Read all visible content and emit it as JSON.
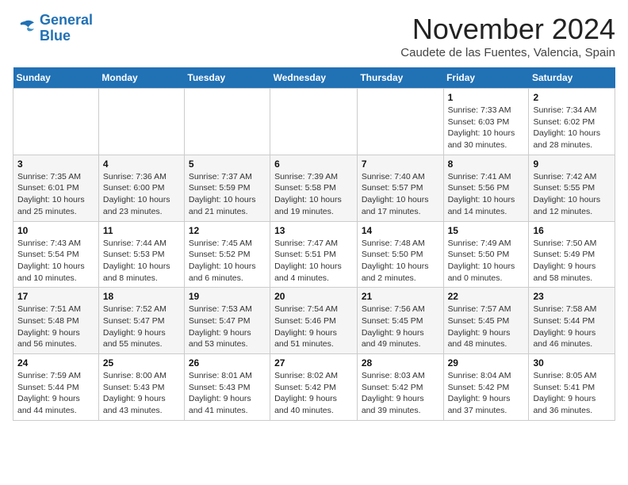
{
  "header": {
    "logo_line1": "General",
    "logo_line2": "Blue",
    "month": "November 2024",
    "location": "Caudete de las Fuentes, Valencia, Spain"
  },
  "weekdays": [
    "Sunday",
    "Monday",
    "Tuesday",
    "Wednesday",
    "Thursday",
    "Friday",
    "Saturday"
  ],
  "weeks": [
    [
      {
        "day": "",
        "info": ""
      },
      {
        "day": "",
        "info": ""
      },
      {
        "day": "",
        "info": ""
      },
      {
        "day": "",
        "info": ""
      },
      {
        "day": "",
        "info": ""
      },
      {
        "day": "1",
        "info": "Sunrise: 7:33 AM\nSunset: 6:03 PM\nDaylight: 10 hours and 30 minutes."
      },
      {
        "day": "2",
        "info": "Sunrise: 7:34 AM\nSunset: 6:02 PM\nDaylight: 10 hours and 28 minutes."
      }
    ],
    [
      {
        "day": "3",
        "info": "Sunrise: 7:35 AM\nSunset: 6:01 PM\nDaylight: 10 hours and 25 minutes."
      },
      {
        "day": "4",
        "info": "Sunrise: 7:36 AM\nSunset: 6:00 PM\nDaylight: 10 hours and 23 minutes."
      },
      {
        "day": "5",
        "info": "Sunrise: 7:37 AM\nSunset: 5:59 PM\nDaylight: 10 hours and 21 minutes."
      },
      {
        "day": "6",
        "info": "Sunrise: 7:39 AM\nSunset: 5:58 PM\nDaylight: 10 hours and 19 minutes."
      },
      {
        "day": "7",
        "info": "Sunrise: 7:40 AM\nSunset: 5:57 PM\nDaylight: 10 hours and 17 minutes."
      },
      {
        "day": "8",
        "info": "Sunrise: 7:41 AM\nSunset: 5:56 PM\nDaylight: 10 hours and 14 minutes."
      },
      {
        "day": "9",
        "info": "Sunrise: 7:42 AM\nSunset: 5:55 PM\nDaylight: 10 hours and 12 minutes."
      }
    ],
    [
      {
        "day": "10",
        "info": "Sunrise: 7:43 AM\nSunset: 5:54 PM\nDaylight: 10 hours and 10 minutes."
      },
      {
        "day": "11",
        "info": "Sunrise: 7:44 AM\nSunset: 5:53 PM\nDaylight: 10 hours and 8 minutes."
      },
      {
        "day": "12",
        "info": "Sunrise: 7:45 AM\nSunset: 5:52 PM\nDaylight: 10 hours and 6 minutes."
      },
      {
        "day": "13",
        "info": "Sunrise: 7:47 AM\nSunset: 5:51 PM\nDaylight: 10 hours and 4 minutes."
      },
      {
        "day": "14",
        "info": "Sunrise: 7:48 AM\nSunset: 5:50 PM\nDaylight: 10 hours and 2 minutes."
      },
      {
        "day": "15",
        "info": "Sunrise: 7:49 AM\nSunset: 5:50 PM\nDaylight: 10 hours and 0 minutes."
      },
      {
        "day": "16",
        "info": "Sunrise: 7:50 AM\nSunset: 5:49 PM\nDaylight: 9 hours and 58 minutes."
      }
    ],
    [
      {
        "day": "17",
        "info": "Sunrise: 7:51 AM\nSunset: 5:48 PM\nDaylight: 9 hours and 56 minutes."
      },
      {
        "day": "18",
        "info": "Sunrise: 7:52 AM\nSunset: 5:47 PM\nDaylight: 9 hours and 55 minutes."
      },
      {
        "day": "19",
        "info": "Sunrise: 7:53 AM\nSunset: 5:47 PM\nDaylight: 9 hours and 53 minutes."
      },
      {
        "day": "20",
        "info": "Sunrise: 7:54 AM\nSunset: 5:46 PM\nDaylight: 9 hours and 51 minutes."
      },
      {
        "day": "21",
        "info": "Sunrise: 7:56 AM\nSunset: 5:45 PM\nDaylight: 9 hours and 49 minutes."
      },
      {
        "day": "22",
        "info": "Sunrise: 7:57 AM\nSunset: 5:45 PM\nDaylight: 9 hours and 48 minutes."
      },
      {
        "day": "23",
        "info": "Sunrise: 7:58 AM\nSunset: 5:44 PM\nDaylight: 9 hours and 46 minutes."
      }
    ],
    [
      {
        "day": "24",
        "info": "Sunrise: 7:59 AM\nSunset: 5:44 PM\nDaylight: 9 hours and 44 minutes."
      },
      {
        "day": "25",
        "info": "Sunrise: 8:00 AM\nSunset: 5:43 PM\nDaylight: 9 hours and 43 minutes."
      },
      {
        "day": "26",
        "info": "Sunrise: 8:01 AM\nSunset: 5:43 PM\nDaylight: 9 hours and 41 minutes."
      },
      {
        "day": "27",
        "info": "Sunrise: 8:02 AM\nSunset: 5:42 PM\nDaylight: 9 hours and 40 minutes."
      },
      {
        "day": "28",
        "info": "Sunrise: 8:03 AM\nSunset: 5:42 PM\nDaylight: 9 hours and 39 minutes."
      },
      {
        "day": "29",
        "info": "Sunrise: 8:04 AM\nSunset: 5:42 PM\nDaylight: 9 hours and 37 minutes."
      },
      {
        "day": "30",
        "info": "Sunrise: 8:05 AM\nSunset: 5:41 PM\nDaylight: 9 hours and 36 minutes."
      }
    ]
  ]
}
